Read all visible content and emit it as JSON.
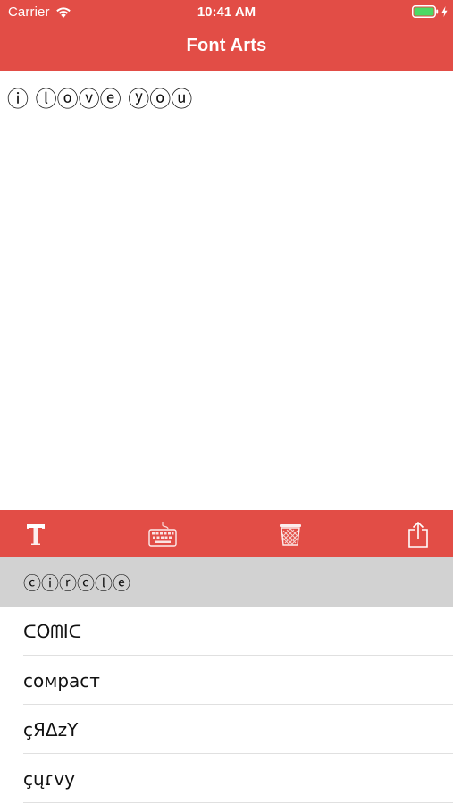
{
  "status_bar": {
    "carrier": "Carrier",
    "time": "10:41 AM"
  },
  "header": {
    "title": "Font Arts"
  },
  "editor": {
    "text": "ⓘ ⓛⓞⓥⓔ ⓨⓞⓤ"
  },
  "toolbar": {
    "icons": [
      "font-icon",
      "keyboard-icon",
      "trash-icon",
      "share-icon"
    ]
  },
  "font_list": [
    {
      "label": "ⓒⓘⓡⓒⓛⓔ",
      "selected": true
    },
    {
      "label": "ᑕOᗰIᑕ",
      "selected": false
    },
    {
      "label": "сомраст",
      "selected": false
    },
    {
      "label": "çЯΔzΥ",
      "selected": false
    },
    {
      "label": "çųɾvy",
      "selected": false
    }
  ],
  "colors": {
    "accent": "#e24d46",
    "selected_row": "#d2d2d2",
    "battery_fill": "#4cd964"
  }
}
